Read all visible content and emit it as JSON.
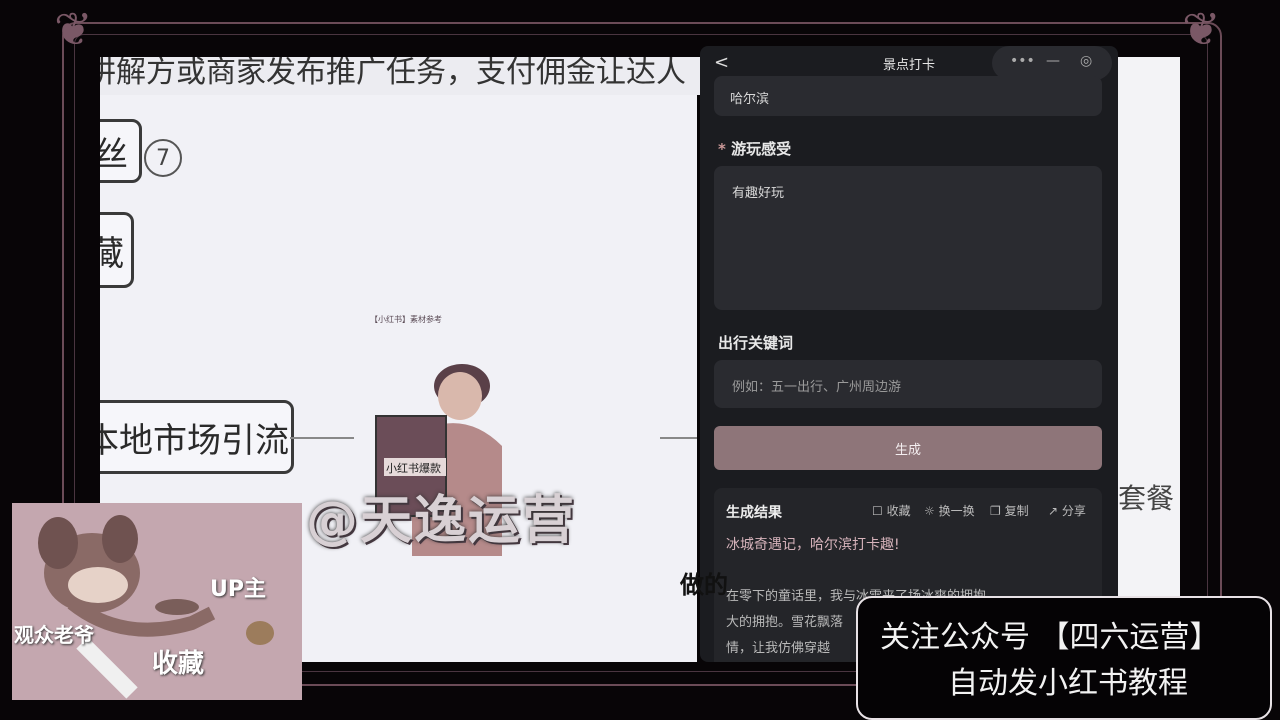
{
  "mindmap": {
    "top_text": "讲解方或商家发布推广任务，支付佣金让达人",
    "node_fans": "丝",
    "node_fans_badge": "7",
    "node_collect": "藏",
    "node_local": "本地市场引流",
    "right_node": "套餐"
  },
  "app": {
    "title": "景点打卡",
    "back_icon": "<",
    "capsule_more": "•••",
    "capsule_min": "—",
    "city_value": "哈尔滨",
    "feeling_required": "*",
    "feeling_label": "游玩感受",
    "feeling_value": "有趣好玩",
    "keywords_label": "出行关键词",
    "keywords_placeholder": "例如：五一出行、广州周边游",
    "generate_label": "生成",
    "result": {
      "title": "生成结果",
      "actions": [
        "收藏",
        "换一换",
        "复制",
        "分享"
      ],
      "headline": "冰城奇遇记，哈尔滨打卡趣!",
      "body_lines": [
        "在零下的童话里，我与冰雪来了场冰爽的拥抱",
        "大的拥抱。雪花飘落",
        "情，让我仿佛穿越"
      ]
    }
  },
  "overlay": {
    "book_caption": "【小红书】素材参考",
    "book_cover": "小红书爆款",
    "watermark": "@天逸运营",
    "caption_mid": "做的",
    "tom_up": "UP主",
    "tom_audience": "观众老爷",
    "tom_collect": "收藏",
    "promo_line1": "关注公众号 【四六运营】",
    "promo_line2": "自动发小红书教程"
  }
}
